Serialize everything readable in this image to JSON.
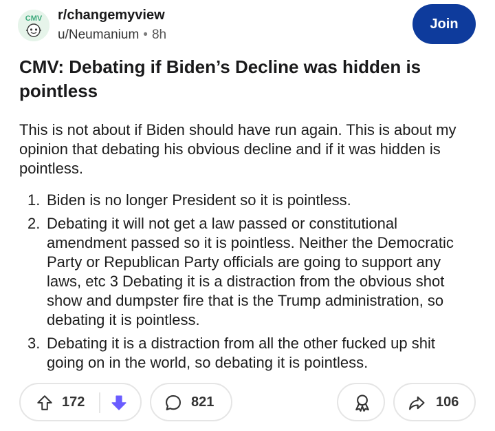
{
  "post": {
    "subreddit": "r/changemyview",
    "avatar_label": "CMV",
    "author": "u/Neumanium",
    "separator": "•",
    "time": "8h",
    "join_label": "Join",
    "title": "CMV: Debating if Biden’s Decline was hidden is pointless",
    "body_intro": "This is not about if Biden should have run again. This is about my opinion that debating his obvious decline and if it was hidden is pointless.",
    "list": [
      {
        "num": "1.",
        "text": "Biden is no longer President so it is pointless."
      },
      {
        "num": "2.",
        "text": "Debating it will not get a law passed or constitutional amendment passed so it is pointless. Neither the Democratic Party or Republican Party officials are going to support any laws, etc 3 Debating it is a distraction from the obvious shot show and dumpster fire that is the Trump administration, so debating it is pointless."
      },
      {
        "num": "3.",
        "text": "Debating it is a distraction from all the other fucked up shit going on in the world, so debating it is pointless."
      }
    ]
  },
  "actions": {
    "upvotes": "172",
    "comments": "821",
    "shares": "106",
    "icons": {
      "upvote": "arrow-up-icon",
      "downvote": "arrow-down-icon",
      "comment": "speech-bubble-icon",
      "award": "award-icon",
      "share": "share-arrow-icon"
    },
    "colors": {
      "join_bg": "#0e3b9c",
      "downvote_active": "#6a5cff",
      "avatar_bg": "#e6f4ea"
    }
  }
}
